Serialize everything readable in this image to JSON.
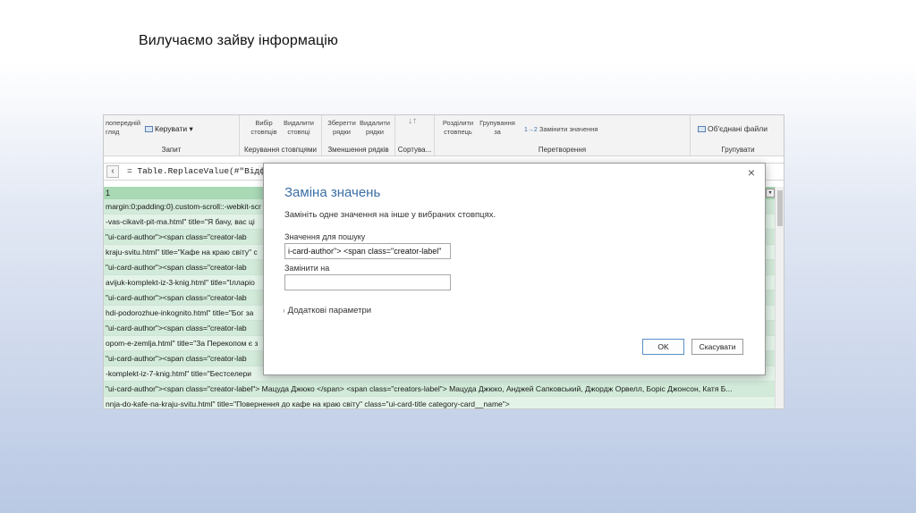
{
  "slide": {
    "title": "Вилучаємо зайву інформацію"
  },
  "ribbon": {
    "groups": [
      {
        "label": "Запит",
        "buttons": [
          "попередній",
          "гляд",
          "Керувати"
        ]
      },
      {
        "label": "Керування стовпцями",
        "buttons": [
          "Вибір стовпців",
          "Видалити стовпці"
        ]
      },
      {
        "label": "Зменшення рядків",
        "buttons": [
          "Зберегти рядки",
          "Видалити рядки"
        ]
      },
      {
        "label": "Сортува...",
        "buttons": []
      },
      {
        "label": "Перетворення",
        "buttons": [
          "Розділити стовпець",
          "Групування за",
          "Замінити значення"
        ]
      },
      {
        "label": "Групувати",
        "buttons": [
          "Об'єднані файли"
        ]
      }
    ]
  },
  "formula_bar": {
    "text": "= Table.ReplaceValue(#\"Відфіл"
  },
  "grid": {
    "header": "1",
    "rows": [
      "margin:0;padding:0}.custom-scroll::-webkit-scr",
      "-vas-cikavit-pit-ma.html\" title=\"Я бачу, вас ці",
      "\"ui-card-author\"><span class=\"creator-lab",
      "kraju-svitu.html\" title=\"Кафе на краю світу\" c",
      "\"ui-card-author\"><span class=\"creator-lab",
      "avijuk-komplekt-iz-3-knig.html\" title=\"Ілларіо",
      "\"ui-card-author\"><span class=\"creator-lab",
      "hdi-podorozhue-inkognito.html\" title=\"Бог за",
      "\"ui-card-author\"><span class=\"creator-lab",
      "opom-e-zemlja.html\" title=\"За Перекопом є з",
      "\"ui-card-author\"><span class=\"creator-lab",
      "-komplekt-iz-7-knig.html\" title=\"Бестселери",
      "\"ui-card-author\"><span class=\"creator-label\"> Мацуда Джюко </span> <span class=\"creators-label\"> Мацуда Джюко, Анджей Сапковський, Джордж Орвелл, Боріс Джонсон, Катя Б...",
      "nnja-do-kafe-na-kraju-svitu.html\" title=\"Повернення до кафе на краю світу\" class=\"ui-card-title category-card__name\">"
    ]
  },
  "dialog": {
    "title": "Заміна значень",
    "description": "Замініть одне значення на інше у вибраних стовпцях.",
    "find_label": "Значення для пошуку",
    "find_value": "i-card-author\"> <span class=\"creator-label\"",
    "replace_label": "Замінити на",
    "replace_value": "",
    "advanced_label": "Додаткові параметри",
    "ok_label": "OK",
    "cancel_label": "Скасувати",
    "close_icon": "×"
  }
}
